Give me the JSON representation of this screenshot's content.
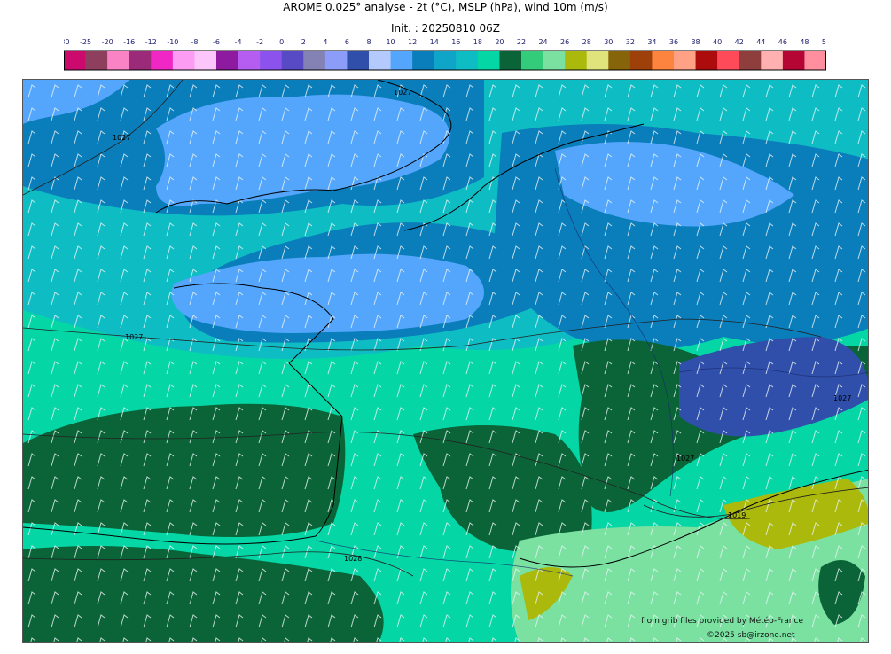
{
  "title": "AROME 0.025° analyse - 2t (°C), MSLP (hPa), wind 10m (m/s)",
  "init": "Init. : 20250810 06Z",
  "legend": {
    "ticks": [
      "-30",
      "-25",
      "-20",
      "-16",
      "-12",
      "-10",
      "-8",
      "-6",
      "-4",
      "-2",
      "0",
      "2",
      "4",
      "6",
      "8",
      "10",
      "12",
      "14",
      "16",
      "18",
      "20",
      "22",
      "24",
      "26",
      "28",
      "30",
      "32",
      "34",
      "36",
      "38",
      "40",
      "42",
      "44",
      "46",
      "48",
      "50"
    ],
    "colors": [
      "#cc0a6e",
      "#8e3f5e",
      "#f983c4",
      "#9b2a78",
      "#f027c5",
      "#fc9cf3",
      "#fdc6fb",
      "#8d1a9f",
      "#b55cf1",
      "#8b52ee",
      "#5849c5",
      "#8482b5",
      "#8b9df9",
      "#2f4faa",
      "#b4c9fc",
      "#53a6fc",
      "#0a7dbb",
      "#0ea5c9",
      "#0ebdc4",
      "#04d6a6",
      "#0a6438",
      "#33cc7a",
      "#7ae1a1",
      "#abb90c",
      "#e0e37c",
      "#866409",
      "#9e4009",
      "#fc843e",
      "#fea185",
      "#ad0c0c",
      "#ff4a5a",
      "#8f3e3e",
      "#ffb0b0",
      "#b50535",
      "#ff8e9f"
    ]
  },
  "map": {
    "isobar_labels": [
      "1027",
      "1027",
      "1027",
      "1028",
      "1027",
      "1027",
      "1019"
    ],
    "credit_source": "from grib files provided by Météo-France",
    "credit_copyright": "©2025 sb@irzone.net"
  }
}
